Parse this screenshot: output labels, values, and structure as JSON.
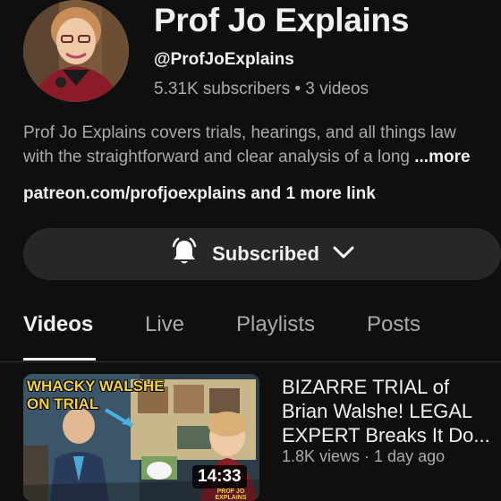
{
  "channel": {
    "name": "Prof Jo Explains",
    "handle": "@ProfJoExplains",
    "stats": "5.31K subscribers • 3 videos",
    "description_line1": "Prof Jo Explains covers trials, hearings, and all things law",
    "description_line2": "with the straightforward and clear analysis of a long ",
    "more_label": "...more",
    "links_text": "patreon.com/profjoexplains and 1 more link"
  },
  "subscribe": {
    "label": "Subscribed",
    "bell_icon": "notification-bell-icon",
    "chevron_icon": "chevron-down-icon"
  },
  "tabs": [
    {
      "label": "Videos",
      "active": true
    },
    {
      "label": "Live",
      "active": false
    },
    {
      "label": "Playlists",
      "active": false
    },
    {
      "label": "Posts",
      "active": false
    }
  ],
  "videos": [
    {
      "title": "BIZARRE TRIAL of Brian Walshe! LEGAL EXPERT Breaks It Do...",
      "meta": "1.8K views · 1 day ago",
      "duration": "14:33",
      "thumbnail_text_1": "WHACKY WALSHE",
      "thumbnail_text_2": "ON TRIAL",
      "thumbnail_logo": "PROF JO EXPLAINS"
    }
  ],
  "colors": {
    "background": "#0f0f0f",
    "primary_text": "#f1f1f1",
    "secondary_text": "#aaaaaa",
    "button_bg": "#272727",
    "thumb_caption_yellow": "#f4d13a"
  }
}
